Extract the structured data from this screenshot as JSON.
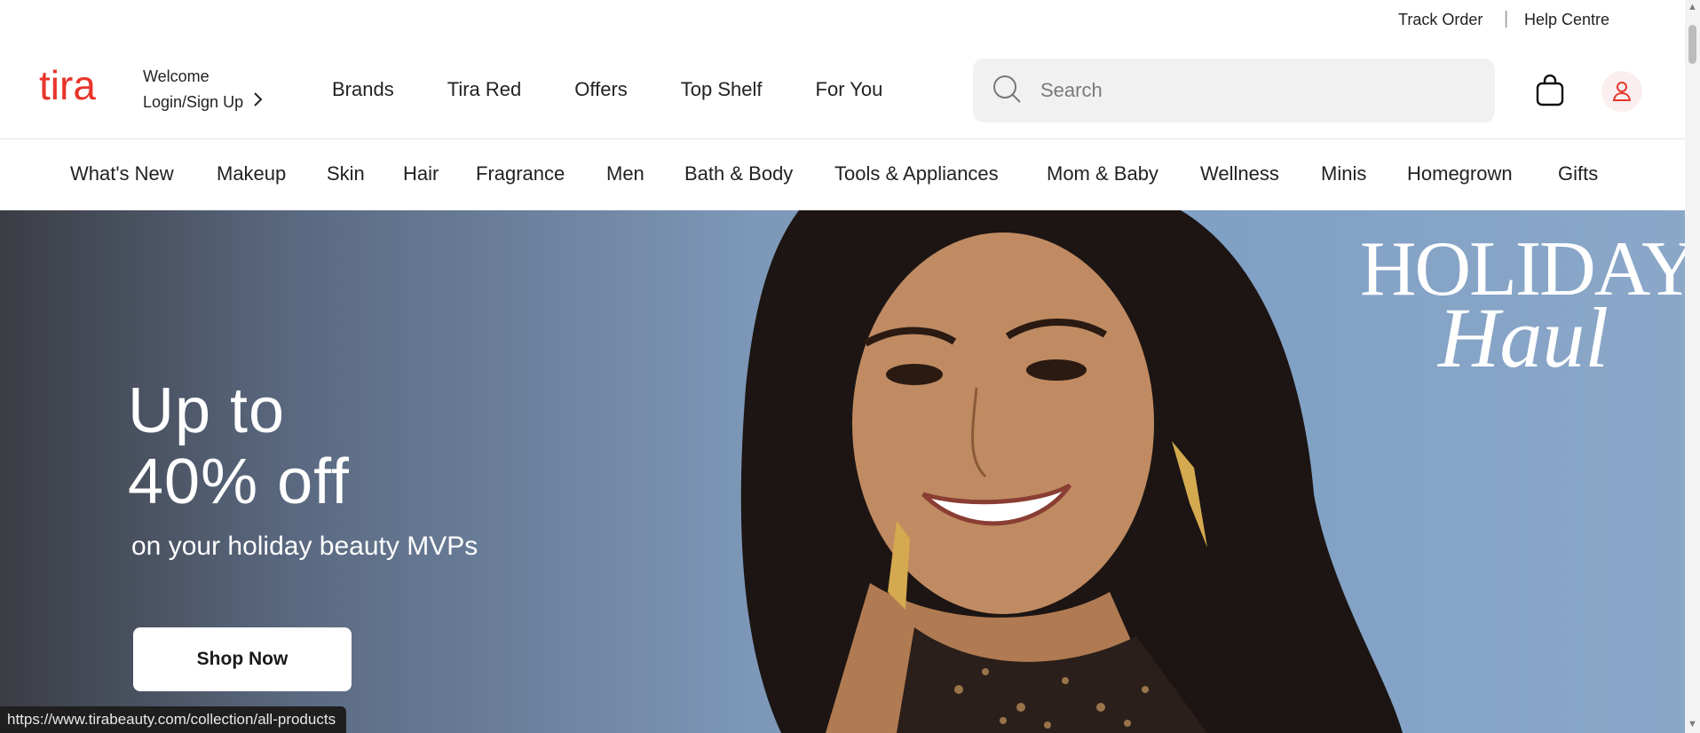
{
  "utility": {
    "track_order": "Track Order",
    "separator": "|",
    "help_centre": "Help Centre"
  },
  "header": {
    "logo_text": "tira",
    "welcome": "Welcome",
    "login": "Login/Sign Up",
    "nav": [
      "Brands",
      "Tira Red",
      "Offers",
      "Top Shelf",
      "For You"
    ],
    "search_placeholder": "Search"
  },
  "categories": [
    "What's New",
    "Makeup",
    "Skin",
    "Hair",
    "Fragrance",
    "Men",
    "Bath & Body",
    "Tools & Appliances",
    "Mom & Baby",
    "Wellness",
    "Minis",
    "Homegrown",
    "Gifts"
  ],
  "hero": {
    "headline_line1": "Up to",
    "headline_line2": "40% off",
    "subtext": "on your holiday beauty MVPs",
    "cta": "Shop Now",
    "badge_line1": "HOLIDAY",
    "badge_line2": "Haul"
  },
  "status_bar": {
    "url": "https://www.tirabeauty.com/collection/all-products"
  },
  "colors": {
    "brand": "#e8352a",
    "hero_bg": "#7d98b8"
  },
  "icons": [
    "tira-logo",
    "chevron-right-icon",
    "search-icon",
    "bag-icon",
    "user-icon"
  ]
}
